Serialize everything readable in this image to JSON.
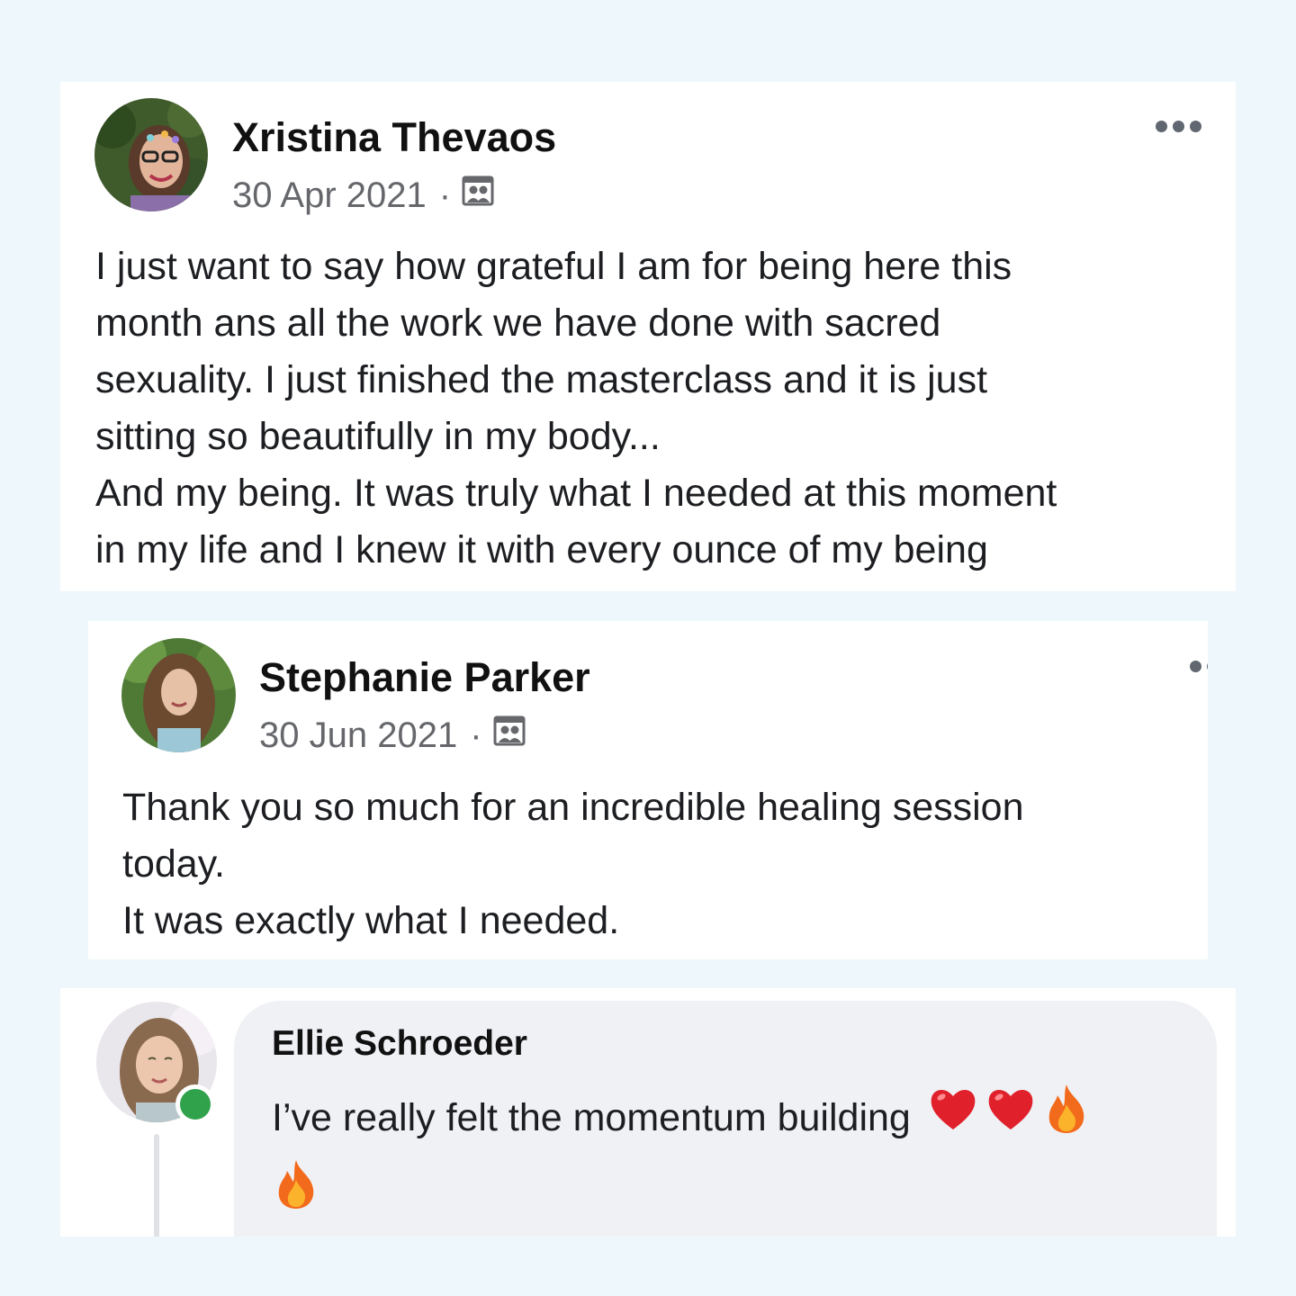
{
  "posts": [
    {
      "author": "Xristina Thevaos",
      "date": "30 Apr 2021",
      "separator": "·",
      "privacy_icon": "group-icon",
      "more_icon": "more-options-icon",
      "lines": [
        "I just want to say how grateful I am for being here this",
        "month ans all the work we have done with sacred",
        "sexuality. I just finished the masterclass and it is just",
        "sitting so beautifully in my body...",
        "And my being. It was truly what I needed at this moment",
        "in my life and I knew it with every ounce of my being"
      ]
    },
    {
      "author": "Stephanie Parker",
      "date": "30 Jun 2021",
      "separator": "·",
      "privacy_icon": "group-icon",
      "more_icon": "more-options-icon",
      "lines": [
        "Thank you so much for an incredible healing session",
        "today.",
        "It was exactly what I needed."
      ]
    }
  ],
  "comment": {
    "author": "Ellie Schroeder",
    "text": "I’ve really felt the momentum building",
    "emojis": [
      "red-heart-emoji",
      "red-heart-emoji",
      "fire-emoji",
      "fire-emoji"
    ],
    "status": "online",
    "status_color": "#31a24c"
  }
}
